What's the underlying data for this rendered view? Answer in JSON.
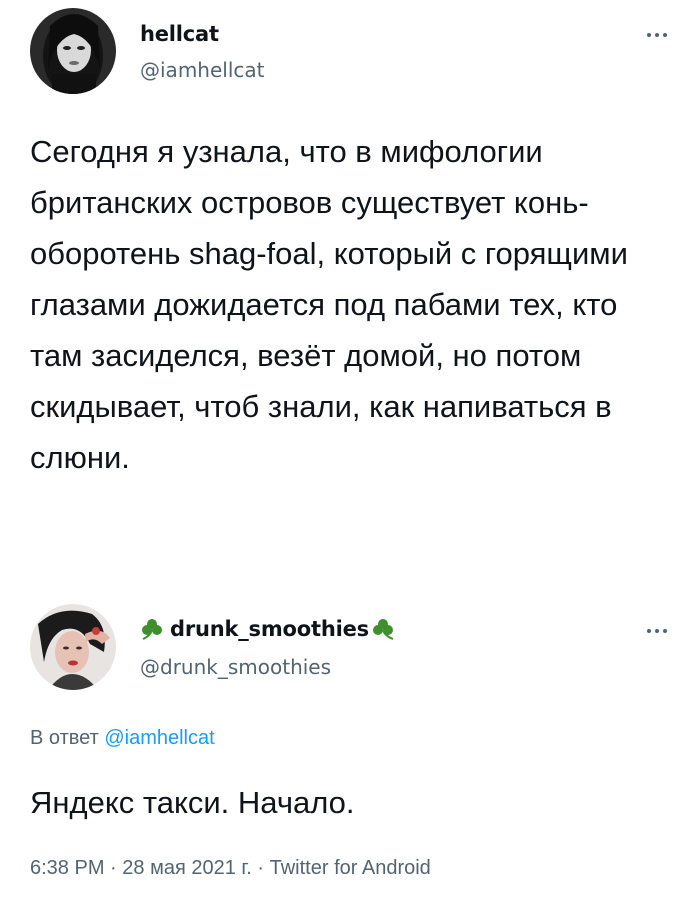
{
  "tweet": {
    "author_name": "hellcat",
    "author_handle": "@iamhellcat",
    "text": "Сегодня я узнала, что в мифологии британских островов существует конь-оборотень shag-foal, который с горящими глазами дожидается под пабами тех, кто там засиделся, везёт домой, но потом скидывает, чтоб знали, как напиваться в слюни.",
    "more_icon": "more-horizontal-icon"
  },
  "reply": {
    "author_name": "drunk_smoothies",
    "author_handle": "@drunk_smoothies",
    "name_decoration_icon": "shamrock-icon",
    "reply_prefix": "В ответ",
    "reply_mention": "@iamhellcat",
    "text": "Яндекс такси. Начало.",
    "time": "6:38 PM",
    "date": "28 мая 2021 г.",
    "separator": "·",
    "source": "Twitter for Android",
    "more_icon": "more-horizontal-icon"
  },
  "colors": {
    "text_primary": "#0f1419",
    "text_secondary": "#536471",
    "link": "#1d9bf0",
    "shamrock": "#3f8f2f"
  }
}
